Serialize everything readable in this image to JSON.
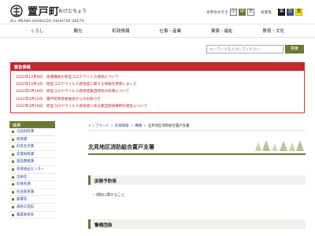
{
  "header": {
    "logo_name": "置戸町",
    "logo_kana": "おけとちょう",
    "logo_roman": "ALL MEANS   HOKKAIDO OKHOTSK OKETO",
    "text_size_label": "文字の大きさ",
    "text_size_options": [
      "小",
      "中",
      "大"
    ],
    "bg_color_label": "背景色",
    "bg_color_options": [
      "黒",
      "青",
      "黄"
    ]
  },
  "nav": {
    "items": [
      "くらし",
      "観光",
      "町政情報",
      "仕事・産業",
      "健康・福祉",
      "教育・文化"
    ]
  },
  "search": {
    "placeholder": "キーワードを入力してください",
    "button_label": "検索"
  },
  "emergency": {
    "title": "緊急情報",
    "items": [
      {
        "date": "2022年12月6日",
        "text": "役場職員の新型コロナウイルス感染について"
      },
      {
        "date": "2022年10月3日",
        "text": "新型コロナウイルス感染症に関する情報を更新しました"
      },
      {
        "date": "2022年5月18日",
        "text": "新型コロナウイルス感染症集団感染の収束について"
      },
      {
        "date": "2022年4月22日",
        "text": "置戸町教育委員会からのお知らせ"
      },
      {
        "date": "2022年4月19日",
        "text": "新型コロナウイルス感染症に係る集団感染事例の発生について"
      }
    ]
  },
  "sidebar": {
    "title": "機構",
    "items": [
      "企画財政課",
      "総務課",
      "町民生活課",
      "産業振興課",
      "施設整備課",
      "地域福祉センター",
      "出納室",
      "町教育課",
      "社会教育課",
      "図書館",
      "森林工芸館",
      "農業委員会"
    ]
  },
  "breadcrumb": {
    "items": [
      "トップページ",
      "町政情報",
      "機構",
      "北見地区消防組合置戸支署"
    ]
  },
  "page": {
    "title": "北見地区消防組合置戸支署",
    "sections": [
      {
        "heading": "庶務予防係",
        "items": [
          "消防に関すること"
        ]
      },
      {
        "heading": "警備団係",
        "items": []
      }
    ]
  },
  "colors": {
    "accent": "#6b7a33",
    "emergency_red": "#c0282d",
    "link_blue": "#2b4a9a"
  }
}
